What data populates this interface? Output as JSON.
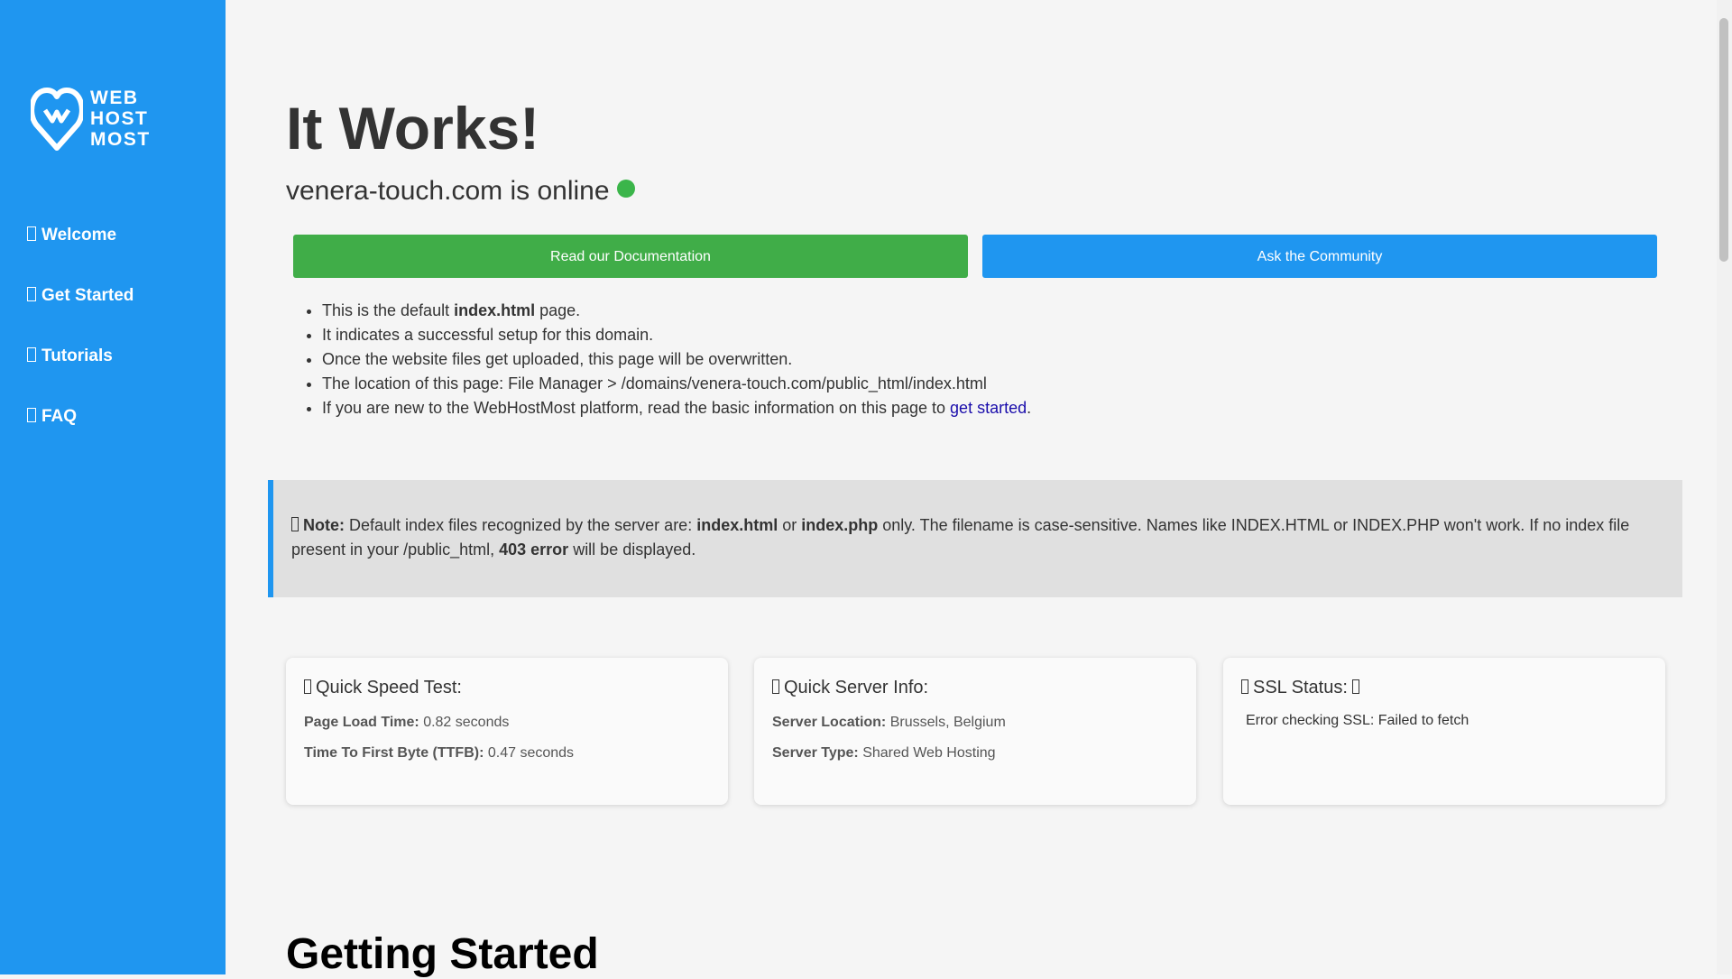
{
  "logo": {
    "line1": "WEB",
    "line2": "HOST",
    "line3": "MOST"
  },
  "nav": [
    {
      "label": "Welcome",
      "icon": "home-icon"
    },
    {
      "label": "Get Started",
      "icon": "rocket-icon"
    },
    {
      "label": "Tutorials",
      "icon": "book-icon"
    },
    {
      "label": "FAQ",
      "icon": "question-icon"
    }
  ],
  "hero": {
    "title": "It Works!",
    "domain_status": "venera-touch.com is online",
    "docs_button": "Read our Documentation",
    "community_button": "Ask the Community"
  },
  "list": {
    "item1_pre": "This is the default ",
    "item1_bold": "index.html",
    "item1_post": " page.",
    "item2": "It indicates a successful setup for this domain.",
    "item3": "Once the website files get uploaded, this page will be overwritten.",
    "item4": "The location of this page: File Manager > /domains/venera-touch.com/public_html/index.html",
    "item5_pre": "If you are new to the WebHostMost platform, read the basic information on this page to ",
    "item5_link": "get started",
    "item5_post": "."
  },
  "note": {
    "label": "Note:",
    "part1": " Default index files recognized by the server are: ",
    "file1": "index.html",
    "part2": " or ",
    "file2": "index.php",
    "part3": " only. The filename is case-sensitive. Names like INDEX.HTML or INDEX.PHP won't work. If no index file present in your /public_html, ",
    "error": "403 error",
    "part4": " will be displayed."
  },
  "speed": {
    "title": "Quick Speed Test:",
    "load_label": "Page Load Time:",
    "load_value": "0.82 seconds",
    "ttfb_label": "Time To First Byte (TTFB):",
    "ttfb_value": "0.47 seconds"
  },
  "server": {
    "title": "Quick Server Info:",
    "location_label": "Server Location:",
    "location_value": "Brussels, Belgium",
    "type_label": "Server Type:",
    "type_value": "Shared Web Hosting"
  },
  "ssl": {
    "title": "SSL Status:",
    "message": "Error checking SSL: Failed to fetch"
  },
  "getting_started": {
    "title": "Getting Started"
  },
  "colors": {
    "sidebar": "#1f96f0",
    "docs_button": "#40ad48",
    "community_button": "#1f96f0",
    "online_dot": "#3bb54a"
  }
}
